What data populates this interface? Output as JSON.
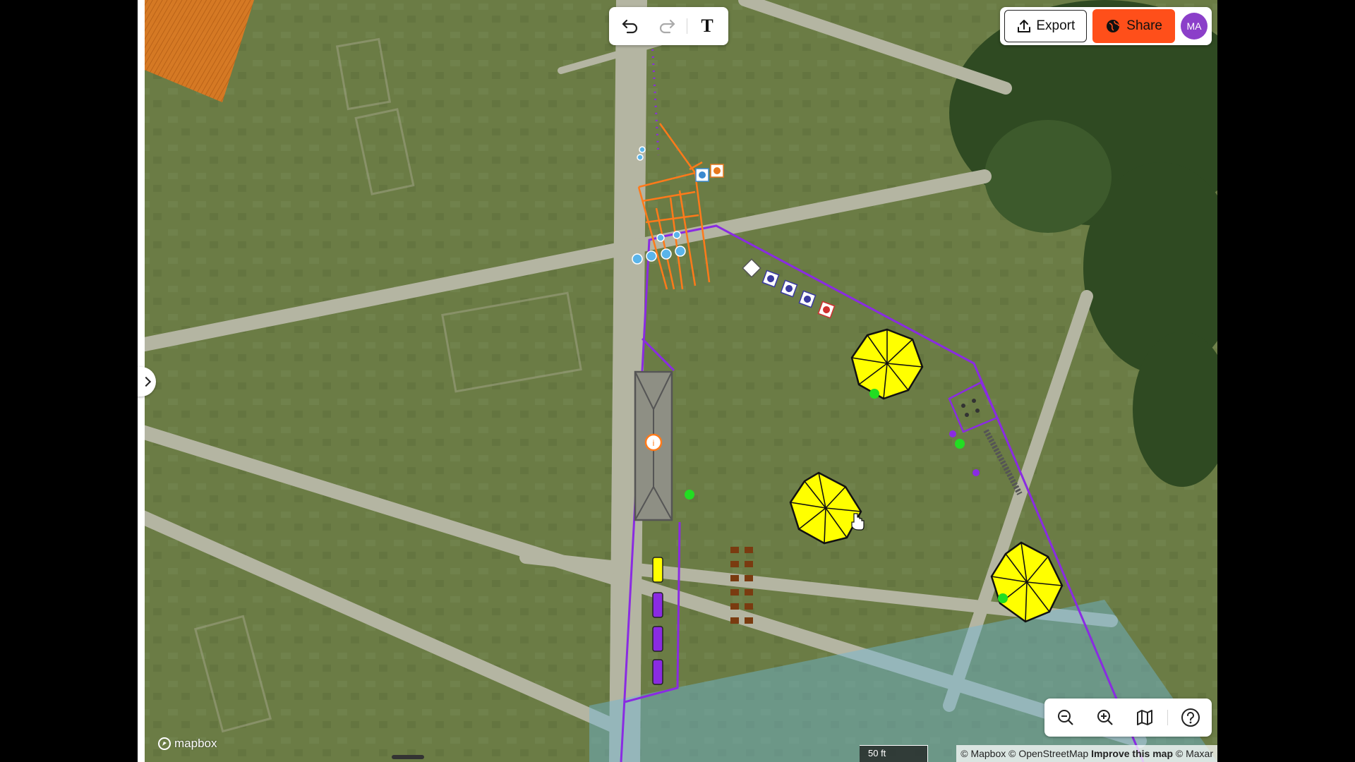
{
  "toolbar": {
    "undo_icon": "undo-icon",
    "redo_icon": "redo-icon",
    "text_label": "T"
  },
  "header": {
    "export_label": "Export",
    "share_label": "Share",
    "avatar_initials": "MA",
    "share_color": "#ff4f1a",
    "avatar_color": "#8b3fc9"
  },
  "map_controls": {
    "zoom_out_icon": "zoom-out-icon",
    "zoom_in_icon": "zoom-in-icon",
    "map_style_icon": "map-icon",
    "help_icon": "help-icon"
  },
  "scale_bar": {
    "label": "50 ft"
  },
  "attribution": {
    "mapbox": "© Mapbox",
    "osm": "© OpenStreetMap",
    "improve": "Improve this map",
    "maxar": "© Maxar"
  },
  "logo_text": "mapbox",
  "colors": {
    "boundary": "#8a2be2",
    "tent": "#ffff00",
    "fence": "#ff7a1a",
    "marker_green": "#22dd22",
    "water_overlay": "#6fb7d8"
  }
}
